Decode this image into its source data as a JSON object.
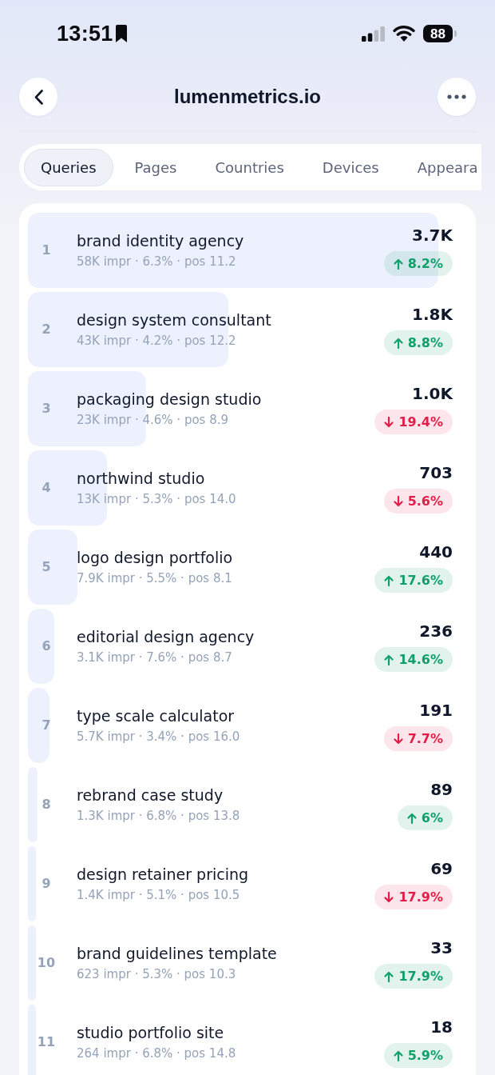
{
  "status_bar": {
    "time": "13:51",
    "battery": "88"
  },
  "header": {
    "title": "lumenmetrics.io"
  },
  "tabs": [
    {
      "label": "Queries",
      "selected": true
    },
    {
      "label": "Pages",
      "selected": false
    },
    {
      "label": "Countries",
      "selected": false
    },
    {
      "label": "Devices",
      "selected": false
    },
    {
      "label": "Appeara",
      "selected": false
    }
  ],
  "queries": [
    {
      "rank": "1",
      "query": "brand identity agency",
      "stats": "58K impr · 6.3% · pos 11.2",
      "clicks": "3.7K",
      "change": "8.2%",
      "rising": true,
      "level": 0.935
    },
    {
      "rank": "2",
      "query": "design system consultant",
      "stats": "43K impr · 4.2% · pos 12.2",
      "clicks": "1.8K",
      "change": "8.8%",
      "rising": true,
      "level": 0.457
    },
    {
      "rank": "3",
      "query": "packaging design studio",
      "stats": "23K impr · 4.6% · pos 8.9",
      "clicks": "1.0K",
      "change": "19.4%",
      "rising": false,
      "level": 0.269
    },
    {
      "rank": "4",
      "query": "northwind studio",
      "stats": "13K impr · 5.3% · pos 14.0",
      "clicks": "703",
      "change": "5.6%",
      "rising": false,
      "level": 0.18
    },
    {
      "rank": "5",
      "query": "logo design portfolio",
      "stats": "7.9K impr · 5.5% · pos 8.1",
      "clicks": "440",
      "change": "17.6%",
      "rising": true,
      "level": 0.113
    },
    {
      "rank": "6",
      "query": "editorial design agency",
      "stats": "3.1K impr · 7.6% · pos 8.7",
      "clicks": "236",
      "change": "14.6%",
      "rising": true,
      "level": 0.06
    },
    {
      "rank": "7",
      "query": "type scale calculator",
      "stats": "5.7K impr · 3.4% · pos 16.0",
      "clicks": "191",
      "change": "7.7%",
      "rising": false,
      "level": 0.049
    },
    {
      "rank": "8",
      "query": "rebrand case study",
      "stats": "1.3K impr · 6.8% · pos 13.8",
      "clicks": "89",
      "change": "6%",
      "rising": true,
      "level": 0.022
    },
    {
      "rank": "9",
      "query": "design retainer pricing",
      "stats": "1.4K impr · 5.1% · pos 10.5",
      "clicks": "69",
      "change": "17.9%",
      "rising": false,
      "level": 0.018
    },
    {
      "rank": "10",
      "query": "brand guidelines template",
      "stats": "623 impr · 5.3% · pos 10.3",
      "clicks": "33",
      "change": "17.9%",
      "rising": true,
      "level": 0.018
    },
    {
      "rank": "11",
      "query": "studio portfolio site",
      "stats": "264 impr · 6.8% · pos 14.8",
      "clicks": "18",
      "change": "5.9%",
      "rising": true,
      "level": 0.018
    }
  ]
}
